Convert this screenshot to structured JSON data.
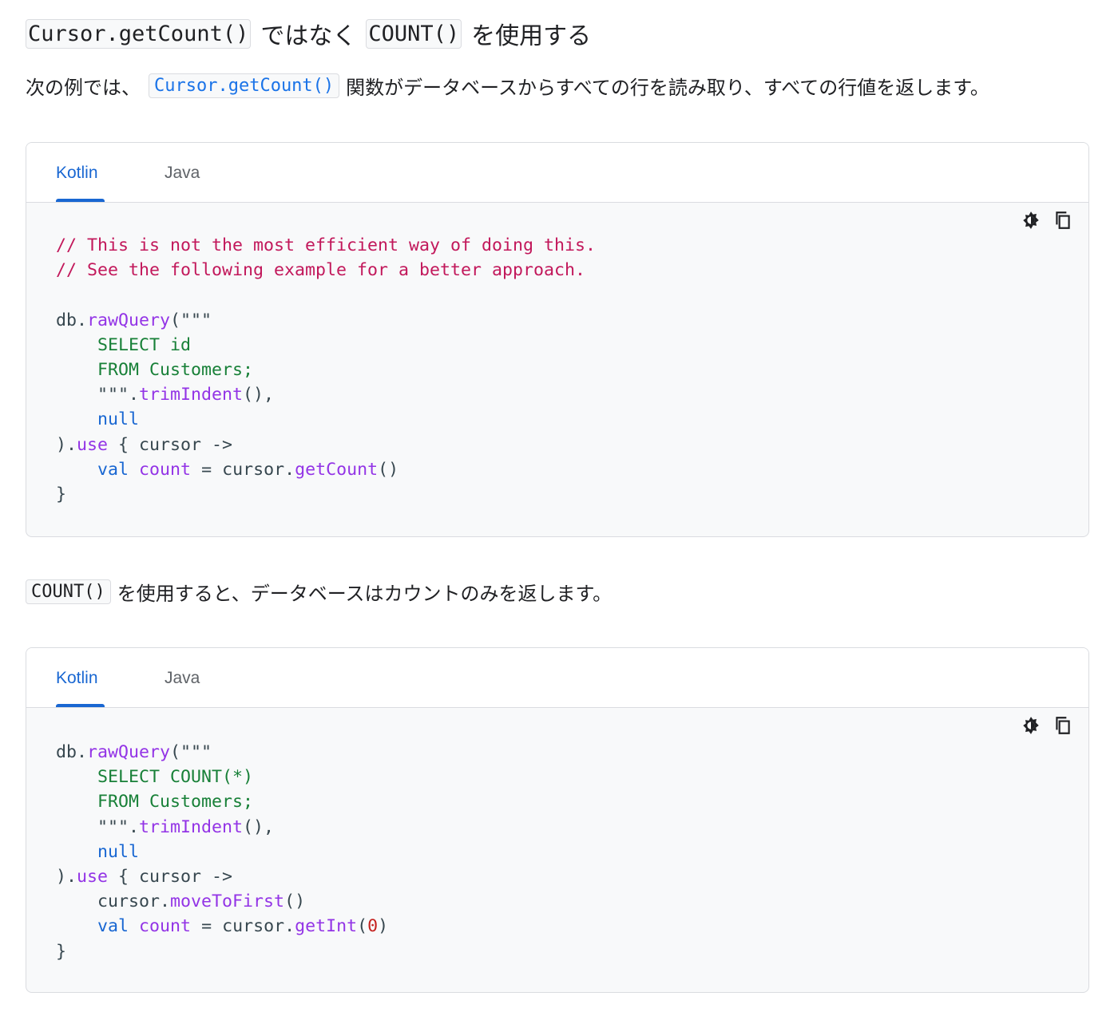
{
  "section1": {
    "heading_code_a": "Cursor.getCount()",
    "heading_text_a": "ではなく",
    "heading_code_b": "COUNT()",
    "heading_text_b": "を使用する",
    "para_prefix": "次の例では、",
    "para_code": "Cursor.getCount()",
    "para_suffix": "関数がデータベースからすべての行を読み取り、すべての行値を返します。"
  },
  "code_block_1": {
    "tabs": [
      "Kotlin",
      "Java"
    ],
    "active_tab": "Kotlin",
    "lines": {
      "comment1": "// This is not the most efficient way of doing this.",
      "comment2": "// See the following example for a better approach.",
      "db": "db",
      "dot": ".",
      "rawQuery": "rawQuery",
      "open_str": "(\"\"\"",
      "select": "    SELECT id",
      "from": "    FROM Customers;",
      "close_str": "    \"\"\"",
      "trimIndent": "trimIndent",
      "trim_tail": "(),",
      "null_indent": "    ",
      "null": "null",
      "close_paren": ")",
      "use": "use",
      "lambda": " { cursor ->",
      "indent": "    ",
      "val": "val",
      "count": "count",
      "assign": " = cursor",
      "getCount": "getCount",
      "call": "()",
      "brace": "}"
    }
  },
  "section2": {
    "para_code": "COUNT()",
    "para_text": "を使用すると、データベースはカウントのみを返します。"
  },
  "code_block_2": {
    "tabs": [
      "Kotlin",
      "Java"
    ],
    "active_tab": "Kotlin",
    "lines": {
      "db": "db",
      "dot": ".",
      "rawQuery": "rawQuery",
      "open_str": "(\"\"\"",
      "select": "    SELECT COUNT(*)",
      "from": "    FROM Customers;",
      "close_str": "    \"\"\"",
      "trimIndent": "trimIndent",
      "trim_tail": "(),",
      "null_indent": "    ",
      "null": "null",
      "close_paren": ")",
      "use": "use",
      "lambda": " { cursor ->",
      "indent": "    ",
      "cursor": "cursor",
      "moveToFirst": "moveToFirst",
      "call": "()",
      "val": "val",
      "count": "count",
      "assign": " = cursor",
      "getInt": "getInt",
      "open": "(",
      "zero": "0",
      "close": ")",
      "brace": "}"
    }
  },
  "icons": {
    "theme_toggle": "brightness-icon",
    "copy": "copy-icon"
  },
  "colors": {
    "link": "#1967d2",
    "comment": "#c2185b",
    "function": "#9334e6",
    "string": "#188038",
    "keyword": "#1967d2",
    "number": "#c5221f"
  }
}
